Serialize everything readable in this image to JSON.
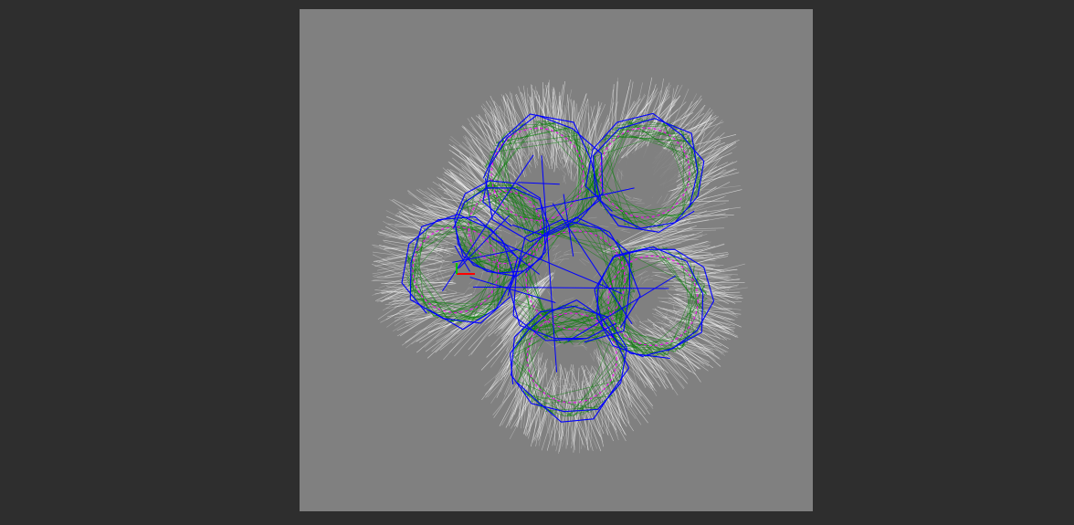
{
  "viewer": {
    "background_color": "#2e2e2e",
    "canvas_color": "#808080",
    "hair_color": "#ffffff",
    "toolpath_color": "#0000ff",
    "boundary_color": "#ff00ff",
    "fill_color": "#008000",
    "axis_x_color": "#ff0000",
    "axis_y_color": "#00c000"
  }
}
